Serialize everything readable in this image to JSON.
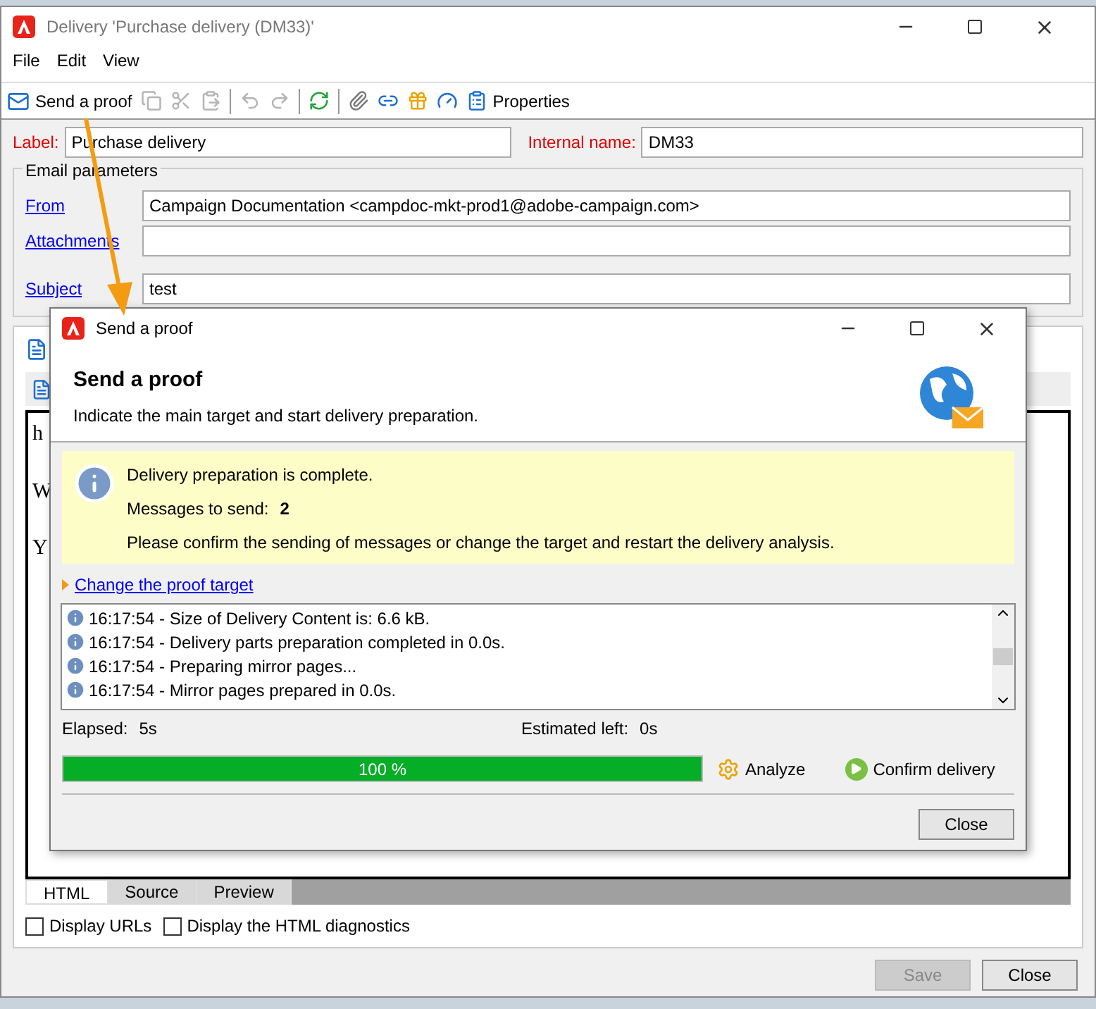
{
  "window": {
    "title": "Delivery 'Purchase delivery (DM33)'"
  },
  "menu": [
    "File",
    "Edit",
    "View"
  ],
  "toolbar": {
    "send_proof": "Send a proof",
    "icon_buttons": [
      {
        "disabled": true
      },
      {
        "disabled": true
      },
      {
        "disabled": true
      },
      {
        "disabled": true
      },
      {
        "disabled": true
      },
      {
        "disabled": false
      },
      {
        "disabled": false
      },
      {
        "disabled": false
      },
      {
        "disabled": false
      },
      {
        "disabled": false
      }
    ],
    "properties": "Properties"
  },
  "label": {
    "caption": "Label:",
    "value": "Purchase delivery"
  },
  "internal_name": {
    "caption": "Internal name:",
    "value": "DM33"
  },
  "email_parameters": {
    "title": "Email parameters",
    "fields": [
      {
        "link": "From",
        "value": "Campaign Documentation <campdoc-mkt-prod1@adobe-campaign.com>"
      },
      {
        "link": "Attachments"
      },
      {
        "link": "Subject",
        "value": "test"
      }
    ]
  },
  "editor_lines": [
    "h",
    "W",
    "Y"
  ],
  "editor_tabs": [
    {
      "label": "HTML",
      "selected": true
    },
    {
      "label": "Source",
      "selected": false
    },
    {
      "label": "Preview",
      "selected": false
    }
  ],
  "options": [
    {
      "label": "Display URLs",
      "checked": false
    },
    {
      "label": "Display the HTML diagnostics",
      "checked": false
    }
  ],
  "buttons": [
    {
      "label": "Save",
      "disabled": true
    },
    {
      "label": "Close",
      "disabled": false
    }
  ],
  "dialog": {
    "title": "Send a proof",
    "heading": "Send a proof",
    "subtitle": "Indicate the main target and start delivery preparation.",
    "status": "Delivery preparation is complete.",
    "messages_caption": "Messages to send:",
    "messages_count": "2",
    "instruction": "Please confirm the sending of messages or change the target and restart the delivery analysis.",
    "change_target": "Change the proof target",
    "log": [
      "16:17:54 - Size of Delivery Content is: 6.6 kB.",
      "16:17:54 - Delivery parts preparation completed in 0.0s.",
      "16:17:54 - Preparing mirror pages...",
      "16:17:54 - Mirror pages prepared in 0.0s."
    ],
    "elapsed_caption": "Elapsed:",
    "elapsed": "5s",
    "estimated_caption": "Estimated left:",
    "estimated": "0s",
    "progress": {
      "level": 1,
      "label": "100 %"
    },
    "analyze": "Analyze",
    "confirm": "Confirm delivery",
    "close": "Close"
  }
}
